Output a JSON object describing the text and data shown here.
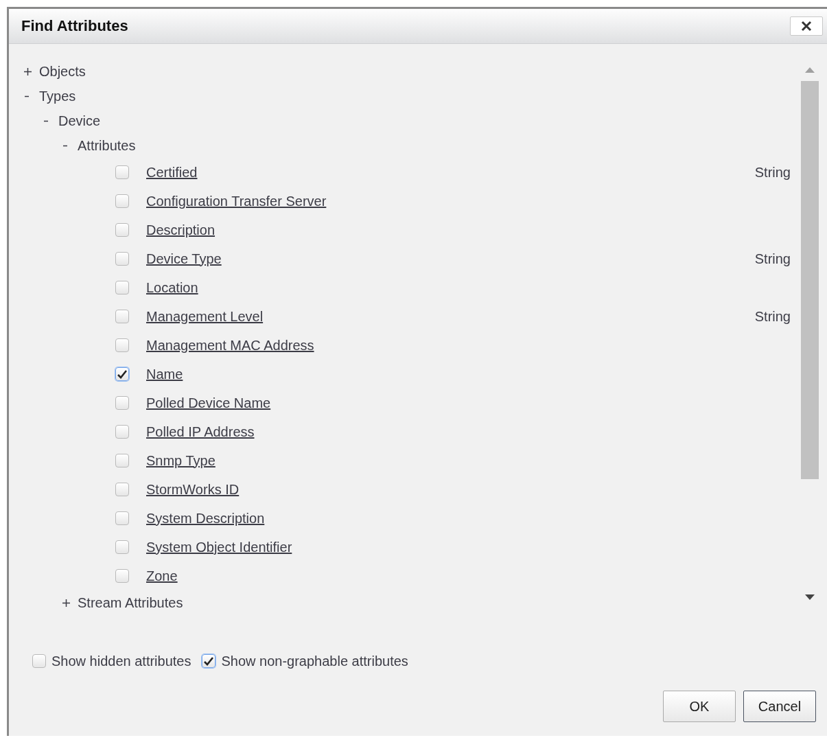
{
  "dialog": {
    "title": "Find Attributes"
  },
  "tree": [
    {
      "kind": "group",
      "label": "Objects",
      "expanded": false
    },
    {
      "kind": "group",
      "label": "Types",
      "expanded": true,
      "children": [
        {
          "kind": "group",
          "label": "Device",
          "expanded": true,
          "children": [
            {
              "kind": "group",
              "label": "Attributes",
              "expanded": true,
              "children": [
                {
                  "kind": "attribute",
                  "label": "Certified",
                  "checked": false,
                  "type": "String"
                },
                {
                  "kind": "attribute",
                  "label": "Configuration Transfer Server",
                  "checked": false
                },
                {
                  "kind": "attribute",
                  "label": "Description",
                  "checked": false
                },
                {
                  "kind": "attribute",
                  "label": "Device Type",
                  "checked": false,
                  "type": "String"
                },
                {
                  "kind": "attribute",
                  "label": "Location",
                  "checked": false
                },
                {
                  "kind": "attribute",
                  "label": "Management Level",
                  "checked": false,
                  "type": "String"
                },
                {
                  "kind": "attribute",
                  "label": "Management MAC Address",
                  "checked": false
                },
                {
                  "kind": "attribute",
                  "label": "Name",
                  "checked": true
                },
                {
                  "kind": "attribute",
                  "label": "Polled Device Name",
                  "checked": false
                },
                {
                  "kind": "attribute",
                  "label": "Polled IP Address",
                  "checked": false
                },
                {
                  "kind": "attribute",
                  "label": "Snmp Type",
                  "checked": false
                },
                {
                  "kind": "attribute",
                  "label": "StormWorks ID",
                  "checked": false
                },
                {
                  "kind": "attribute",
                  "label": "System Description",
                  "checked": false
                },
                {
                  "kind": "attribute",
                  "label": "System Object Identifier",
                  "checked": false
                },
                {
                  "kind": "attribute",
                  "label": "Zone",
                  "checked": false
                }
              ]
            },
            {
              "kind": "group",
              "label": "Stream Attributes",
              "expanded": false
            }
          ]
        }
      ]
    }
  ],
  "options": [
    {
      "label": "Show hidden attributes",
      "checked": false
    },
    {
      "label": "Show non-graphable attributes",
      "checked": true
    }
  ],
  "buttons": [
    {
      "label": "OK",
      "kind": "default"
    },
    {
      "label": "Cancel",
      "kind": "focused"
    }
  ]
}
